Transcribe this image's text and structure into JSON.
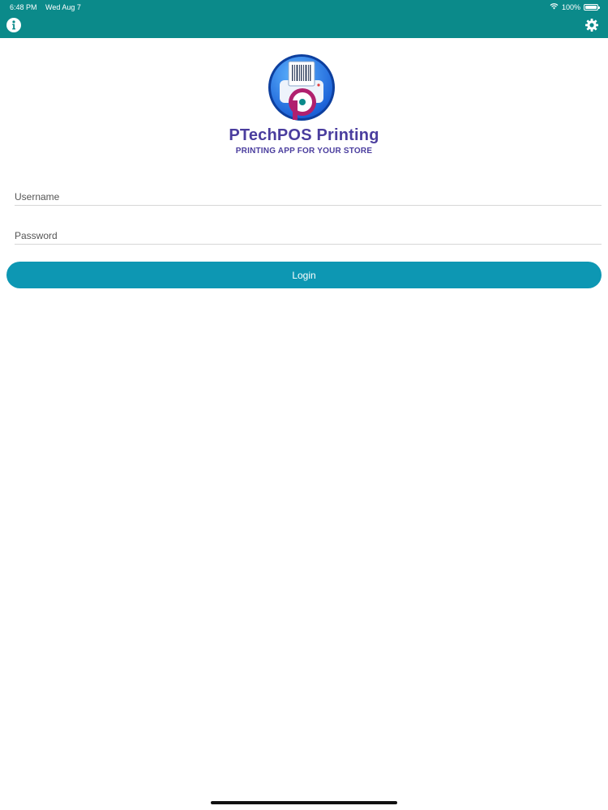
{
  "status_bar": {
    "time": "6:48 PM",
    "date": "Wed Aug 7",
    "battery": "100%",
    "battery_level": 1.0,
    "wifi_icon": "wifi-icon",
    "battery_icon": "battery-icon"
  },
  "nav_bar": {
    "background": "#0b8a8a",
    "info_icon": "info-icon",
    "settings_icon": "gear-icon"
  },
  "brand": {
    "title": "PTechPOS Printing",
    "subtitle": "PRINTING APP FOR YOUR STORE",
    "color": "#4a3d9e",
    "logo_icon": "printer-logo-icon"
  },
  "form": {
    "username": {
      "value": "",
      "placeholder": "Username"
    },
    "password": {
      "value": "",
      "placeholder": "Password"
    },
    "login_label": "Login",
    "login_color": "#0d97b3"
  }
}
